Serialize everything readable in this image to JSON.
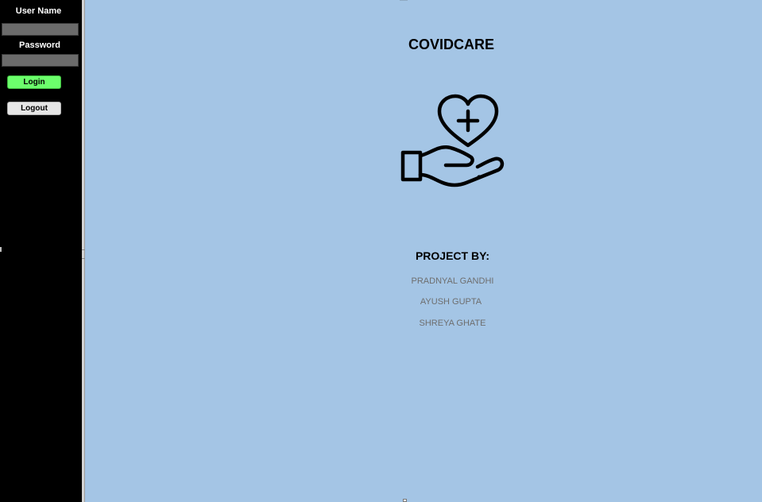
{
  "login_panel": {
    "username_label": "User Name",
    "username_value": "",
    "password_label": "Password",
    "password_value": "",
    "login_button": "Login",
    "logout_button": "Logout",
    "login_button_color": "#6cff6c"
  },
  "main": {
    "title": "COVIDCARE",
    "logo_icon": "heart-plus-in-hand-icon",
    "project_by_label": "PROJECT BY:",
    "members": [
      "PRADNYAL GANDHI",
      "AYUSH GUPTA",
      "SHREYA GHATE"
    ],
    "background_color": "#a4c5e5"
  }
}
